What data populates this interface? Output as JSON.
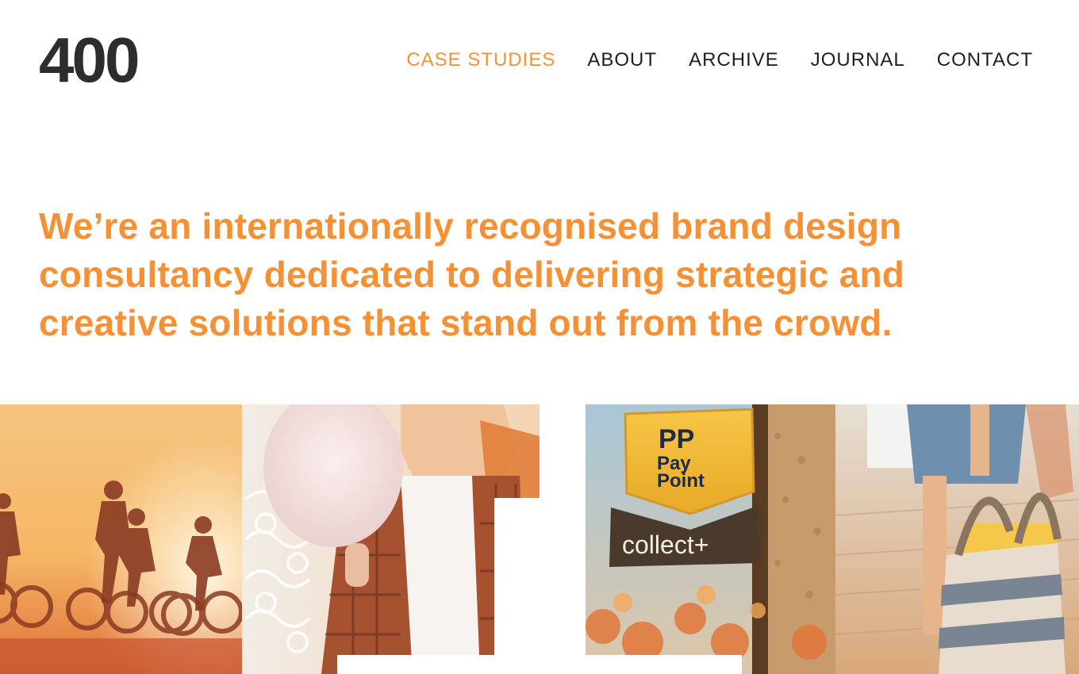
{
  "header": {
    "logo": "400",
    "nav": [
      {
        "label": "CASE STUDIES",
        "active": true
      },
      {
        "label": "ABOUT",
        "active": false
      },
      {
        "label": "ARCHIVE",
        "active": false
      },
      {
        "label": "JOURNAL",
        "active": false
      },
      {
        "label": "CONTACT",
        "active": false
      }
    ]
  },
  "intro": {
    "headline": "We’re an internationally recognised brand design consultancy dedicated to delivering strategic and creative solutions that stand out from the crowd."
  },
  "gallery": {
    "tiles": [
      {
        "name": "cyclists-sunset-image"
      },
      {
        "name": "candy-floss-girl-image"
      },
      {
        "name": "paypoint-collect-sign-image",
        "sign_brand": "PP",
        "sign_line1": "Pay",
        "sign_line2": "Point",
        "sign_sub": "collect+"
      },
      {
        "name": "shopping-bag-image"
      }
    ]
  },
  "colors": {
    "accent": "#f59134",
    "text": "#1f1f1f",
    "logo": "#2d2d2d"
  }
}
